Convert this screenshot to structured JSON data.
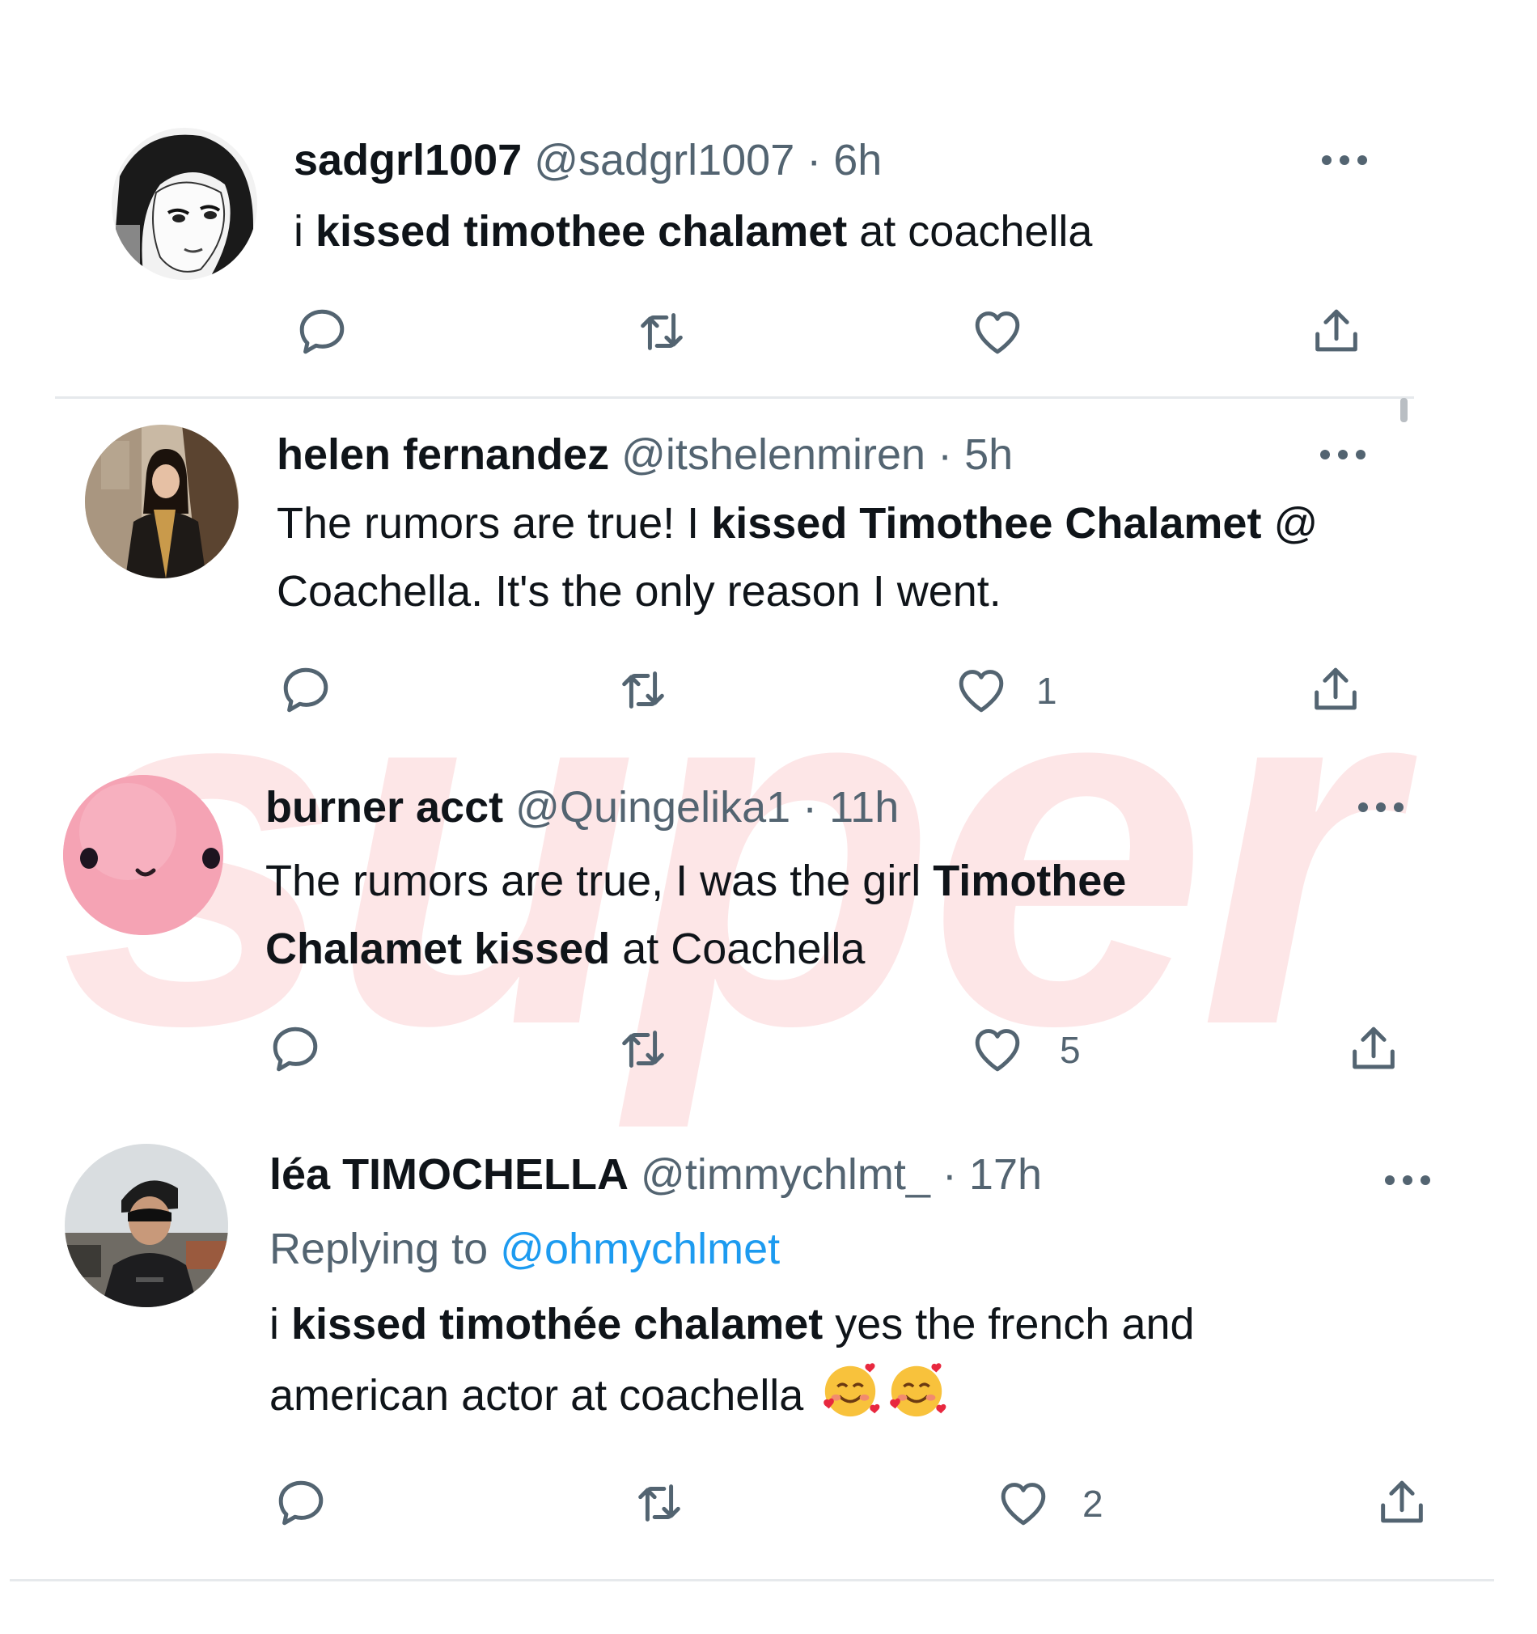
{
  "watermark": "super",
  "tweets": [
    {
      "name": "sadgrl1007",
      "handle": "@sadgrl1007",
      "time": "6h",
      "body": [
        {
          "text": "i ",
          "bold": false
        },
        {
          "text": "kissed timothee chalamet",
          "bold": true
        },
        {
          "text": " at coachella",
          "bold": false
        }
      ],
      "likes": ""
    },
    {
      "name": "helen fernandez",
      "handle": "@itshelenmiren",
      "time": "5h",
      "body": [
        {
          "text": "The rumors are true! I ",
          "bold": false
        },
        {
          "text": "kissed Timothee Chalamet",
          "bold": true
        },
        {
          "text": " @ Coachella. It's the only reason I went.",
          "bold": false
        }
      ],
      "likes": "1"
    },
    {
      "name": "burner acct",
      "handle": "@Quingelika1",
      "time": "11h",
      "body": [
        {
          "text": "The rumors are true, I was the girl ",
          "bold": false
        },
        {
          "text": "Timothee Chalamet kissed",
          "bold": true
        },
        {
          "text": " at Coachella",
          "bold": false
        }
      ],
      "likes": "5"
    },
    {
      "name": "léa TIMOCHELLA",
      "handle": "@timmychlmt_",
      "time": "17h",
      "replying_prefix": "Replying to",
      "replying_handle": "@ohmychlmet",
      "body": [
        {
          "text": "i ",
          "bold": false
        },
        {
          "text": "kissed timothée chalamet",
          "bold": true
        },
        {
          "text": " yes the french and american actor at coachella",
          "bold": false
        }
      ],
      "emoji": [
        "smiling-face-with-hearts",
        "smiling-face-with-hearts"
      ],
      "likes": "2"
    }
  ],
  "icons": {
    "reply": "reply-icon",
    "retweet": "retweet-icon",
    "like": "heart-icon",
    "share": "share-icon",
    "more": "more-icon"
  },
  "colors": {
    "text": "#0f1419",
    "secondary": "#536471",
    "link": "#1d9bf0",
    "watermark": "#fde6e7"
  }
}
